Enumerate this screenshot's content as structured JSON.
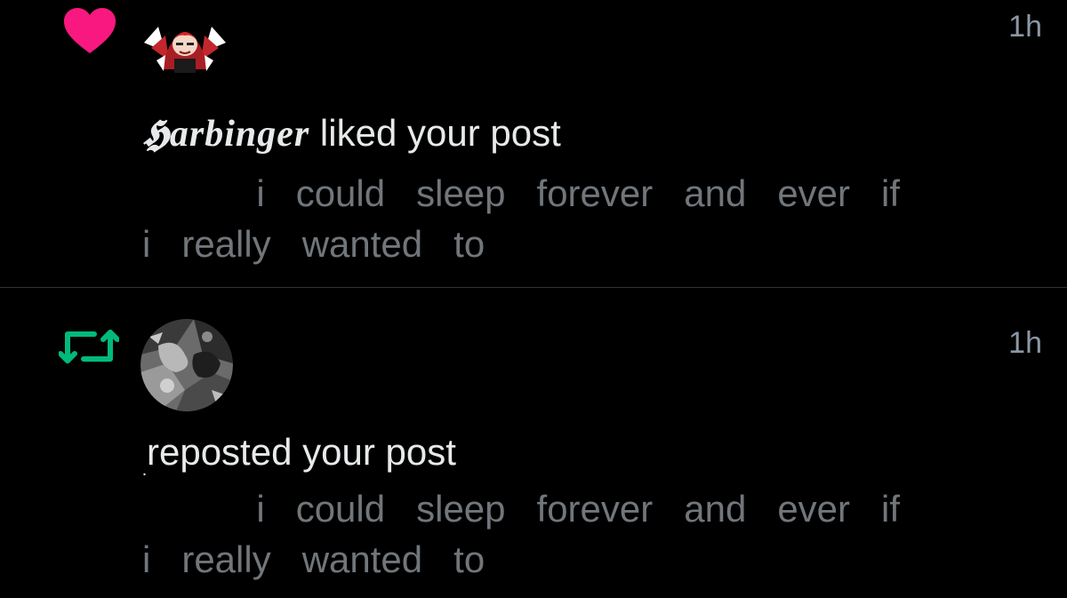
{
  "notifications": [
    {
      "type": "like",
      "icon": "heart-icon",
      "icon_color": "#f91880",
      "avatar": "anime-avatar",
      "timestamp": "1h",
      "username": "𝕳arbinger",
      "action_text": " liked your post",
      "preview_line1": "           i   could   sleep   forever   and   ever   if",
      "preview_line2": "i   really   wanted   to"
    },
    {
      "type": "repost",
      "icon": "repost-icon",
      "icon_color": "#00ba7c",
      "avatar": "grayscale-avatar",
      "timestamp": "1h",
      "username": ".",
      "action_text": "reposted your post",
      "preview_line1": "           i   could   sleep   forever   and   ever   if",
      "preview_line2": "i   really   wanted   to"
    }
  ],
  "colors": {
    "background": "#000000",
    "primary_text": "#e7e9ea",
    "secondary_text": "#71767b",
    "divider": "#2f3336"
  }
}
